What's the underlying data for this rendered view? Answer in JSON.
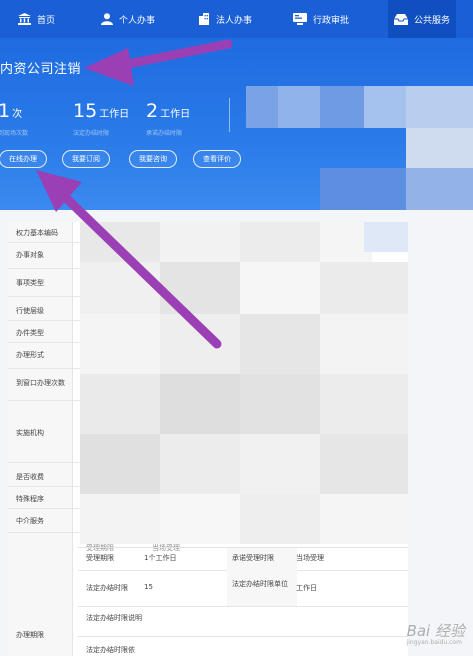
{
  "nav": {
    "items": [
      {
        "label": "首页",
        "icon": "bank-icon"
      },
      {
        "label": "个人办事",
        "icon": "person-icon"
      },
      {
        "label": "法人办事",
        "icon": "building-icon"
      },
      {
        "label": "行政审批",
        "icon": "approval-icon"
      },
      {
        "label": "公共服务",
        "icon": "inbox-icon"
      }
    ]
  },
  "hero": {
    "title": "内资公司注销",
    "stats": [
      {
        "num": "1",
        "unit": "次",
        "label": "到现场次数"
      },
      {
        "num": "15",
        "unit": "工作日",
        "label": "法定办结时限"
      },
      {
        "num": "2",
        "unit": "工作日",
        "label": "承诺办结时限"
      }
    ],
    "buttons": [
      "在线办理",
      "我要订阅",
      "我要咨询",
      "查看评价"
    ]
  },
  "table": {
    "labels": [
      "权力基本编码",
      "办事对象",
      "事项类型",
      "行使层级",
      "办件类型",
      "办理形式",
      "到窗口办理次数",
      "实施机构",
      "是否收费",
      "特殊程序",
      "中介服务",
      "办理期限"
    ],
    "sub_rows": [
      {
        "k1": "受理期限",
        "v1": "1个工作日",
        "k2": "承诺受理时限",
        "v2": "当场受理"
      },
      {
        "k1": "法定办结时限",
        "v1": "15",
        "k2": "法定办结时限单位",
        "v2": "工作日"
      },
      {
        "k1": "法定办结时限说明",
        "v1": "",
        "k2": "",
        "v2": ""
      },
      {
        "k1": "法定办结时限依",
        "v1": "",
        "k2": "",
        "v2": ""
      }
    ],
    "partial_top_label": "受理期限",
    "partial_top_value": "当场受理"
  },
  "colors": {
    "nav_bg": "#1a5fd6",
    "hero_bg": "#2a7be9",
    "arrow": "#9b3fb5"
  },
  "watermark": {
    "main": "Bai 经验",
    "sub": "jingyan.baidu.com"
  }
}
